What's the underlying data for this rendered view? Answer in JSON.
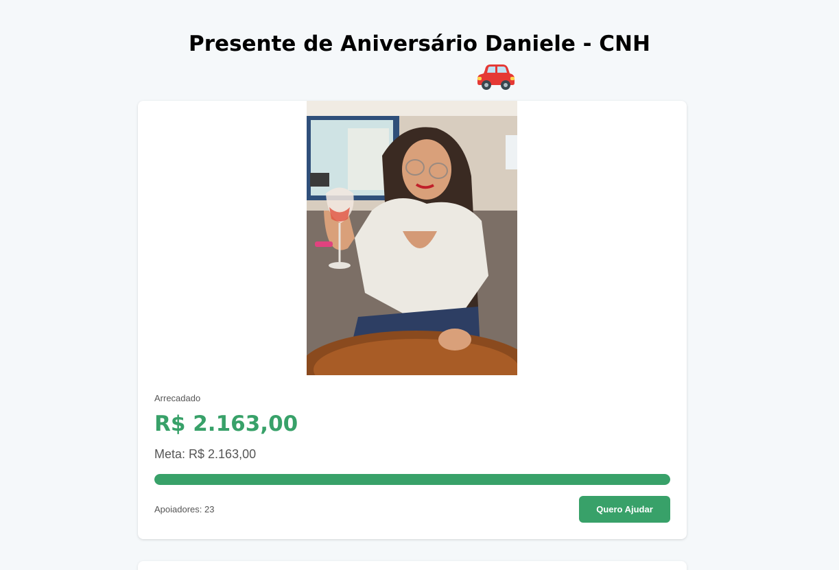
{
  "page": {
    "title": "Presente de Aniversário Daniele - CNH",
    "title_emoji": "car-emoji"
  },
  "campaign": {
    "photo": "woman-holding-wine-glass-photo",
    "raised_label": "Arrecadado",
    "raised_value": "R$ 2.163,00",
    "goal_text": "Meta: R$ 2.163,00",
    "progress_fraction": 1.0,
    "supporters_label": "Apoiadores:",
    "supporters_count": "23",
    "help_button_label": "Quero Ajudar"
  },
  "colors": {
    "accent": "#38a169",
    "background": "#f5f8fa",
    "card": "#ffffff"
  }
}
